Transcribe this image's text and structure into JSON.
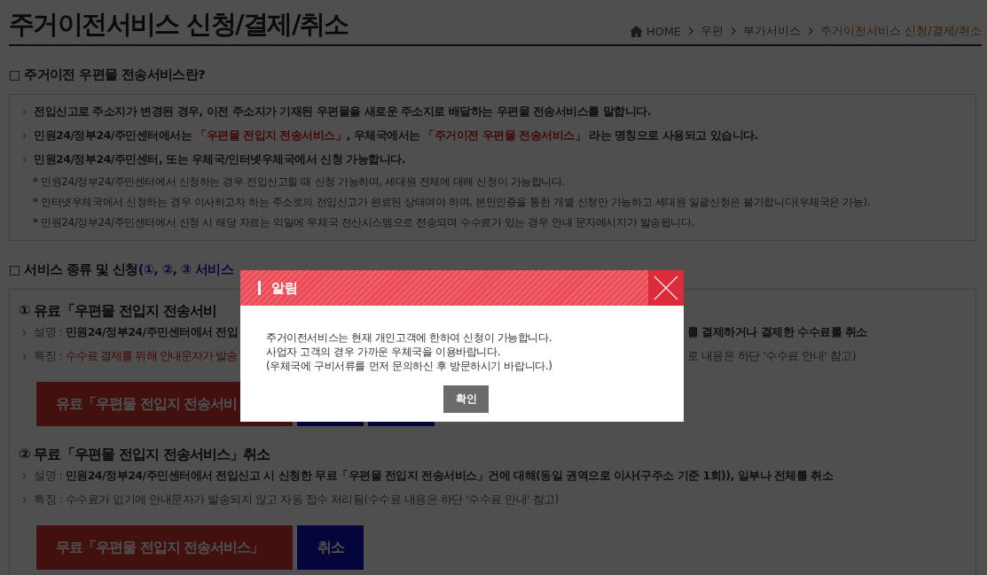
{
  "page_title": "주거이전서비스 신청/결제/취소",
  "breadcrumb": [
    {
      "label": "HOME",
      "kind": "home",
      "current": false
    },
    {
      "label": "우편",
      "kind": "link",
      "current": false
    },
    {
      "label": "부가서비스",
      "kind": "link",
      "current": false
    },
    {
      "label": "주거이전서비스 신청/결제/취소",
      "kind": "link",
      "current": true
    }
  ],
  "section_1": {
    "marker": "□",
    "heading": "주거이전 우편물 전송서비스란?",
    "bullets": [
      [
        {
          "text": "전입신고로 주소지가 변경된 경우, 이전 주소지가 기재된 우편물을 새로운 주소지로 배달하는 우편물 전송서비스를 말합니다.",
          "red": false
        }
      ],
      [
        {
          "text": "민원24/정부24/주민센터에서는 ",
          "red": false
        },
        {
          "text": "「우편물 전입지 전송서비스」",
          "red": true
        },
        {
          "text": ", 우체국에서는 ",
          "red": false
        },
        {
          "text": "「주거이전 우편물 전송서비스」",
          "red": true
        },
        {
          "text": " 라는 명칭으로 사용되고 있습니다.",
          "red": false
        }
      ],
      [
        {
          "text": "민원24/정부24/주민센터, 또는 우체국/인터넷우체국에서 신청 가능합니다.",
          "red": false
        }
      ]
    ],
    "notes": [
      "* 민원24/정부24/주민센터에서 신청하는 경우 전입신고할 때 신청 가능하며, 세대원 전체에 대해 신청이 가능합니다.",
      "* 인터넷우체국에서 신청하는 경우 이사하고자 하는 주소로의 전입신고가 완료된 상태여야 하며, 본인인증을 통한 개별 신청만 가능하고 세대원 일괄신청은 불가합니다(우체국은 가능).",
      "* 민원24/정부24/주민센터에서 신청 시 해당 자료는 익일에 우체국 전산시스템으로 전송되며 수수료가 있는 경우 안내 문자메시지가 발송됩니다."
    ]
  },
  "section_2": {
    "marker": "□",
    "heading": "서비스 종류 및 신청",
    "hint": "(①, ②, ③ 서비스",
    "services": [
      {
        "heading": "① 유료「우편물 전입지 전송서비",
        "lines": [
          {
            "label": "설명 : ",
            "kind": "bold",
            "left": "민원24/정부24/주민센터에서 전입",
            "right": "를 결제하거나 결제한 수수료를 취소"
          },
          {
            "label": "특징 : ",
            "kind": "red",
            "left": "수수료 결제를 위해 안내문자가 발송",
            "right": "로 내용은 하단 '수수료 안내' 참고)"
          }
        ],
        "buttons": [
          {
            "label": "유료「우편물 전입지 전송서비",
            "kind": "red"
          },
          {
            "kind": "blue"
          },
          {
            "kind": "blue"
          }
        ]
      },
      {
        "heading": "② 무료「우편물 전입지 전송서비스」취소",
        "lines": [
          {
            "label": "설명 : ",
            "kind": "bold",
            "left": "민원24/정부24/주민센터에서 전입신고 시 신청한 무료「우편물 전입지 전송서비스」건에 대해(동일 권역으로 이사(구주소 기준 1회)), 일부나 전체를 취소"
          },
          {
            "label": "특징 : ",
            "kind": "plain",
            "left": "수수료가 없기에 안내문자가 발송되지 않고 자동 접수 처리됨(수수료 내용은 하단 '수수료 안내' 참고)"
          }
        ],
        "buttons": [
          {
            "label": "무료「우편물 전입지 전송서비스」",
            "kind": "red"
          },
          {
            "label": "취소",
            "kind": "blue"
          }
        ]
      }
    ]
  },
  "dialog": {
    "title": "알림",
    "lines": [
      "주거이전서비스는 현재 개인고객에 한하여 신청이 가능합니다.",
      "사업자 고객의 경우 가까운 우체국을 이용바랍니다.",
      "(우체국에 구비서류를 먼저 문의하신 후 방문하시기 바랍니다.)"
    ],
    "button": "확인"
  }
}
